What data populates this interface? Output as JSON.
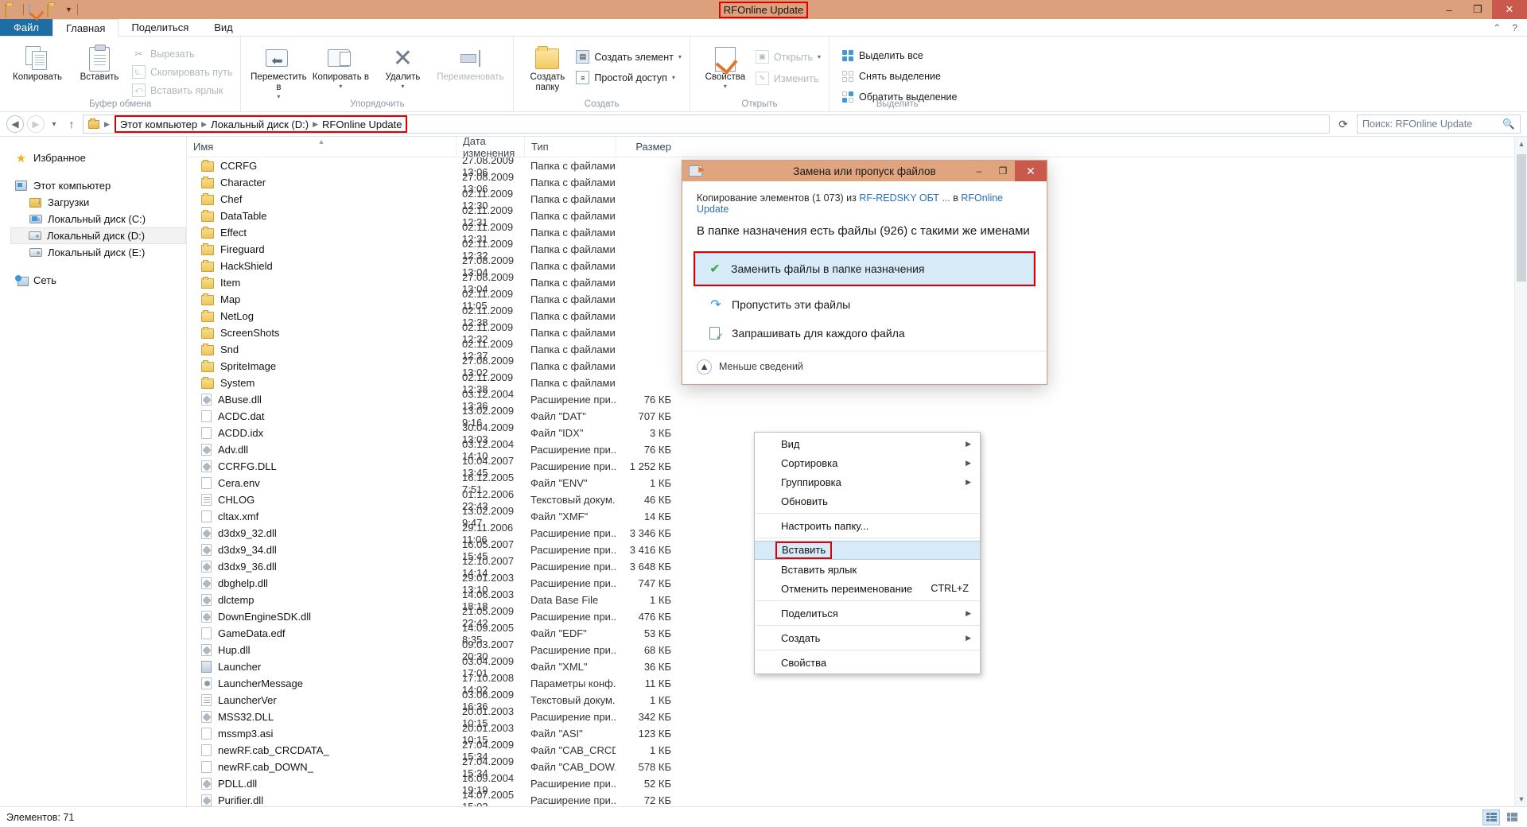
{
  "window": {
    "title": "RFOnline Update",
    "quick_access": [
      "folder-icon",
      "properties-icon",
      "new-folder-icon",
      "chevron-down-icon"
    ],
    "caption_buttons": {
      "minimize": "–",
      "restore": "❐",
      "close": "✕"
    }
  },
  "ribbon": {
    "tabs": [
      {
        "label": "Файл",
        "type": "file"
      },
      {
        "label": "Главная",
        "type": "active"
      },
      {
        "label": "Поделиться",
        "type": "normal"
      },
      {
        "label": "Вид",
        "type": "normal"
      }
    ],
    "help_buttons": [
      "chevron-up-icon",
      "help-icon"
    ],
    "groups": [
      {
        "label": "Буфер обмена",
        "big": [
          {
            "label": "Копировать",
            "icon": "copy-icon"
          },
          {
            "label": "Вставить",
            "icon": "paste-icon"
          }
        ],
        "small": [
          {
            "label": "Вырезать",
            "icon": "scissors-icon",
            "disabled": true
          },
          {
            "label": "Скопировать путь",
            "icon": "copy-path-icon",
            "disabled": true
          },
          {
            "label": "Вставить ярлык",
            "icon": "paste-shortcut-icon",
            "disabled": true
          }
        ]
      },
      {
        "label": "Упорядочить",
        "big": [
          {
            "label": "Переместить в",
            "icon": "move-to-icon",
            "caret": true
          },
          {
            "label": "Копировать в",
            "icon": "copy-to-icon",
            "caret": true
          },
          {
            "label": "Удалить",
            "icon": "delete-icon",
            "caret": true
          },
          {
            "label": "Переименовать",
            "icon": "rename-icon",
            "disabled": true
          }
        ],
        "small": []
      },
      {
        "label": "Создать",
        "big": [
          {
            "label": "Создать папку",
            "icon": "new-folder-icon"
          }
        ],
        "small": [
          {
            "label": "Создать элемент",
            "icon": "new-item-icon",
            "caret": true
          },
          {
            "label": "Простой доступ",
            "icon": "easy-access-icon",
            "caret": true
          }
        ]
      },
      {
        "label": "Открыть",
        "big": [
          {
            "label": "Свойства",
            "icon": "properties-icon",
            "caret": true
          }
        ],
        "small": [
          {
            "label": "Открыть",
            "icon": "open-icon",
            "caret": true,
            "disabled": true
          },
          {
            "label": "Изменить",
            "icon": "edit-icon",
            "disabled": true
          }
        ]
      },
      {
        "label": "Выделить",
        "big": [],
        "small": [
          {
            "label": "Выделить все",
            "icon": "select-all-icon"
          },
          {
            "label": "Снять выделение",
            "icon": "select-none-icon"
          },
          {
            "label": "Обратить выделение",
            "icon": "invert-selection-icon"
          }
        ]
      }
    ]
  },
  "address_bar": {
    "back": "back-icon",
    "forward": "forward-icon",
    "recent": "recent-locations-icon",
    "up": "up-icon",
    "breadcrumbs": [
      "Этот компьютер",
      "Локальный диск (D:)",
      "RFOnline Update"
    ],
    "refresh": "refresh-icon",
    "search_placeholder": "Поиск: RFOnline Update"
  },
  "nav_pane": [
    {
      "label": "Избранное",
      "icon": "star-icon",
      "indent": false,
      "selected": false,
      "gap_after": true
    },
    {
      "label": "Этот компьютер",
      "icon": "computer-icon",
      "indent": false,
      "selected": false
    },
    {
      "label": "Загрузки",
      "icon": "downloads-icon",
      "indent": true,
      "selected": false
    },
    {
      "label": "Локальный диск (C:)",
      "icon": "system-drive-icon",
      "indent": true,
      "selected": false
    },
    {
      "label": "Локальный диск (D:)",
      "icon": "drive-icon",
      "indent": true,
      "selected": true
    },
    {
      "label": "Локальный диск (E:)",
      "icon": "drive-icon",
      "indent": true,
      "selected": false,
      "gap_after": true
    },
    {
      "label": "Сеть",
      "icon": "network-icon",
      "indent": false,
      "selected": false
    }
  ],
  "file_list": {
    "columns": [
      "Имя",
      "Дата изменения",
      "Тип",
      "Размер"
    ],
    "sort_column": 0,
    "rows": [
      {
        "name": "CCRFG",
        "date": "27.08.2009 13:06",
        "type": "Папка с файлами",
        "size": "",
        "icon": "folder"
      },
      {
        "name": "Character",
        "date": "27.08.2009 13:06",
        "type": "Папка с файлами",
        "size": "",
        "icon": "folder"
      },
      {
        "name": "Chef",
        "date": "02.11.2009 12:30",
        "type": "Папка с файлами",
        "size": "",
        "icon": "folder"
      },
      {
        "name": "DataTable",
        "date": "02.11.2009 12:31",
        "type": "Папка с файлами",
        "size": "",
        "icon": "folder"
      },
      {
        "name": "Effect",
        "date": "02.11.2009 12:31",
        "type": "Папка с файлами",
        "size": "",
        "icon": "folder"
      },
      {
        "name": "Fireguard",
        "date": "02.11.2009 12:32",
        "type": "Папка с файлами",
        "size": "",
        "icon": "folder"
      },
      {
        "name": "HackShield",
        "date": "27.08.2009 13:04",
        "type": "Папка с файлами",
        "size": "",
        "icon": "folder"
      },
      {
        "name": "Item",
        "date": "27.08.2009 13:04",
        "type": "Папка с файлами",
        "size": "",
        "icon": "folder"
      },
      {
        "name": "Map",
        "date": "02.11.2009 11:05",
        "type": "Папка с файлами",
        "size": "",
        "icon": "folder"
      },
      {
        "name": "NetLog",
        "date": "02.11.2009 12:38",
        "type": "Папка с файлами",
        "size": "",
        "icon": "folder"
      },
      {
        "name": "ScreenShots",
        "date": "02.11.2009 12:32",
        "type": "Папка с файлами",
        "size": "",
        "icon": "folder"
      },
      {
        "name": "Snd",
        "date": "02.11.2009 12:37",
        "type": "Папка с файлами",
        "size": "",
        "icon": "folder"
      },
      {
        "name": "SpriteImage",
        "date": "27.08.2009 13:02",
        "type": "Папка с файлами",
        "size": "",
        "icon": "folder"
      },
      {
        "name": "System",
        "date": "02.11.2009 12:38",
        "type": "Папка с файлами",
        "size": "",
        "icon": "folder"
      },
      {
        "name": "ABuse.dll",
        "date": "03.12.2004 13:36",
        "type": "Расширение при...",
        "size": "76 КБ",
        "icon": "dll"
      },
      {
        "name": "ACDC.dat",
        "date": "13.02.2009 9:16",
        "type": "Файл \"DAT\"",
        "size": "707 КБ",
        "icon": "file"
      },
      {
        "name": "ACDD.idx",
        "date": "30.04.2009 13:03",
        "type": "Файл \"IDX\"",
        "size": "3 КБ",
        "icon": "file"
      },
      {
        "name": "Adv.dll",
        "date": "03.12.2004 14:10",
        "type": "Расширение при...",
        "size": "76 КБ",
        "icon": "dll"
      },
      {
        "name": "CCRFG.DLL",
        "date": "10.04.2007 13:45",
        "type": "Расширение при...",
        "size": "1 252 КБ",
        "icon": "dll"
      },
      {
        "name": "Cera.env",
        "date": "16.12.2005 7:51",
        "type": "Файл \"ENV\"",
        "size": "1 КБ",
        "icon": "file"
      },
      {
        "name": "CHLOG",
        "date": "01.12.2006 22:43",
        "type": "Текстовый докум...",
        "size": "46 КБ",
        "icon": "txt"
      },
      {
        "name": "cltax.xmf",
        "date": "13.02.2009 9:47",
        "type": "Файл \"XMF\"",
        "size": "14 КБ",
        "icon": "file"
      },
      {
        "name": "d3dx9_32.dll",
        "date": "29.11.2006 11:06",
        "type": "Расширение при...",
        "size": "3 346 КБ",
        "icon": "dll"
      },
      {
        "name": "d3dx9_34.dll",
        "date": "16.05.2007 15:45",
        "type": "Расширение при...",
        "size": "3 416 КБ",
        "icon": "dll"
      },
      {
        "name": "d3dx9_36.dll",
        "date": "12.10.2007 14:14",
        "type": "Расширение при...",
        "size": "3 648 КБ",
        "icon": "dll"
      },
      {
        "name": "dbghelp.dll",
        "date": "29.01.2003 13:10",
        "type": "Расширение при...",
        "size": "747 КБ",
        "icon": "dll"
      },
      {
        "name": "dlctemp",
        "date": "14.06.2003 18:18",
        "type": "Data Base File",
        "size": "1 КБ",
        "icon": "dll"
      },
      {
        "name": "DownEngineSDK.dll",
        "date": "21.05.2009 22:42",
        "type": "Расширение при...",
        "size": "476 КБ",
        "icon": "dll"
      },
      {
        "name": "GameData.edf",
        "date": "14.09.2005 8:35",
        "type": "Файл \"EDF\"",
        "size": "53 КБ",
        "icon": "file"
      },
      {
        "name": "Hup.dll",
        "date": "09.03.2007 20:30",
        "type": "Расширение при...",
        "size": "68 КБ",
        "icon": "dll"
      },
      {
        "name": "Launcher",
        "date": "03.04.2009 17:01",
        "type": "Файл \"XML\"",
        "size": "36 КБ",
        "icon": "xml"
      },
      {
        "name": "LauncherMessage",
        "date": "17.10.2008 14:02",
        "type": "Параметры конф...",
        "size": "11 КБ",
        "icon": "cfg"
      },
      {
        "name": "LauncherVer",
        "date": "03.06.2009 16:36",
        "type": "Текстовый докум...",
        "size": "1 КБ",
        "icon": "txt"
      },
      {
        "name": "MSS32.DLL",
        "date": "20.01.2003 10:15",
        "type": "Расширение при...",
        "size": "342 КБ",
        "icon": "dll"
      },
      {
        "name": "mssmp3.asi",
        "date": "20.01.2003 10:15",
        "type": "Файл \"ASI\"",
        "size": "123 КБ",
        "icon": "file"
      },
      {
        "name": "newRF.cab_CRCDATA_",
        "date": "27.04.2009 15:34",
        "type": "Файл \"CAB_CRCD...",
        "size": "1 КБ",
        "icon": "file"
      },
      {
        "name": "newRF.cab_DOWN_",
        "date": "27.04.2009 15:34",
        "type": "Файл \"CAB_DOW...",
        "size": "578 КБ",
        "icon": "file"
      },
      {
        "name": "PDLL.dll",
        "date": "16.09.2004 19:19",
        "type": "Расширение при...",
        "size": "52 КБ",
        "icon": "dll"
      },
      {
        "name": "Purifier.dll",
        "date": "14.07.2005 15:02",
        "type": "Расширение при...",
        "size": "72 КБ",
        "icon": "dll"
      }
    ]
  },
  "status_bar": {
    "text": "Элементов: 71",
    "view_buttons": [
      "details-view-icon",
      "large-icons-view-icon"
    ]
  },
  "dialog": {
    "title": "Замена или пропуск файлов",
    "icon": "file-copy-icon",
    "caption_buttons": {
      "minimize": "–",
      "restore": "❐",
      "close": "✕"
    },
    "subtitle_prefix": "Копирование элементов (1 073) из ",
    "source_link": "RF-REDSKY ОБТ ...",
    "subtitle_middle": " в ",
    "target_link": "RFOnline Update",
    "heading": "В папке назначения есть файлы (926) с такими же именами",
    "options": [
      {
        "label": "Заменить файлы в папке назначения",
        "icon": "green-check-icon",
        "selected": true,
        "highlighted": true
      },
      {
        "label": "Пропустить эти файлы",
        "icon": "skip-arrow-icon",
        "selected": false,
        "highlighted": false
      },
      {
        "label": "Запрашивать для каждого файла",
        "icon": "ask-each-icon",
        "selected": false,
        "highlighted": false
      }
    ],
    "footer": {
      "label": "Меньше сведений",
      "icon": "chevron-up-circle-icon"
    }
  },
  "context_menu": {
    "items": [
      {
        "label": "Вид",
        "submenu": true
      },
      {
        "label": "Сортировка",
        "submenu": true
      },
      {
        "label": "Группировка",
        "submenu": true
      },
      {
        "label": "Обновить",
        "submenu": false
      },
      {
        "separator": true
      },
      {
        "label": "Настроить папку...",
        "submenu": false
      },
      {
        "separator": true
      },
      {
        "label": "Вставить",
        "submenu": false,
        "highlighted": true
      },
      {
        "label": "Вставить ярлык",
        "submenu": false
      },
      {
        "label": "Отменить переименование",
        "submenu": false,
        "accel": "CTRL+Z"
      },
      {
        "separator": true
      },
      {
        "label": "Поделиться",
        "submenu": true
      },
      {
        "separator": true
      },
      {
        "label": "Создать",
        "submenu": true
      },
      {
        "separator": true
      },
      {
        "label": "Свойства",
        "submenu": false
      }
    ]
  },
  "annotation_color": "#e00000"
}
